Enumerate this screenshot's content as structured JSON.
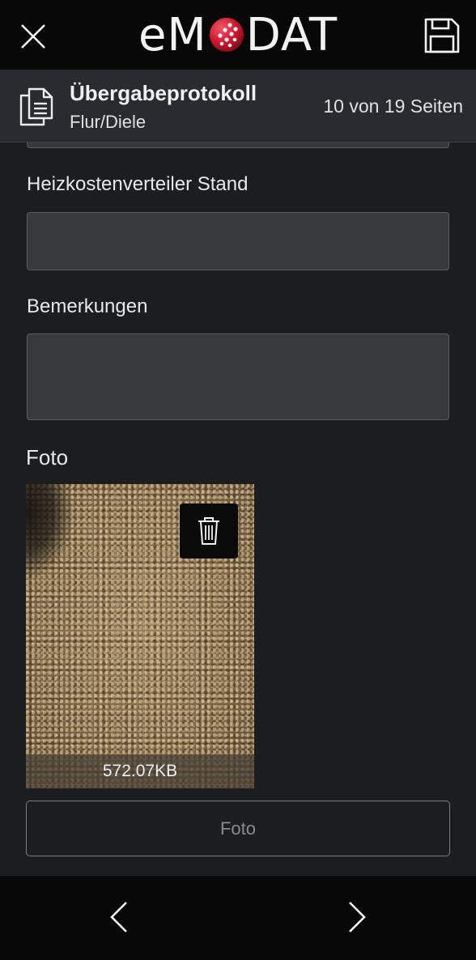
{
  "topbar": {
    "logo_left": "eM",
    "logo_right": "DAT",
    "close_icon": "close-icon",
    "save_icon": "floppy-disk-icon",
    "logo_ball_color": "#d3192d"
  },
  "header": {
    "icon": "document-icon",
    "title": "Übergabeprotokoll",
    "subtitle": "Flur/Diele",
    "page_counter": "10 von 19 Seiten"
  },
  "form": {
    "heizkosten_label": "Heizkostenverteiler Stand",
    "heizkosten_value": "",
    "bemerkungen_label": "Bemerkungen",
    "bemerkungen_value": "",
    "foto_label": "Foto",
    "photo": {
      "file_size": "572.07KB",
      "delete_icon": "trash-icon"
    },
    "foto_button_label": "Foto"
  },
  "bottom_nav": {
    "prev_icon": "chevron-left-icon",
    "next_icon": "chevron-right-icon"
  }
}
